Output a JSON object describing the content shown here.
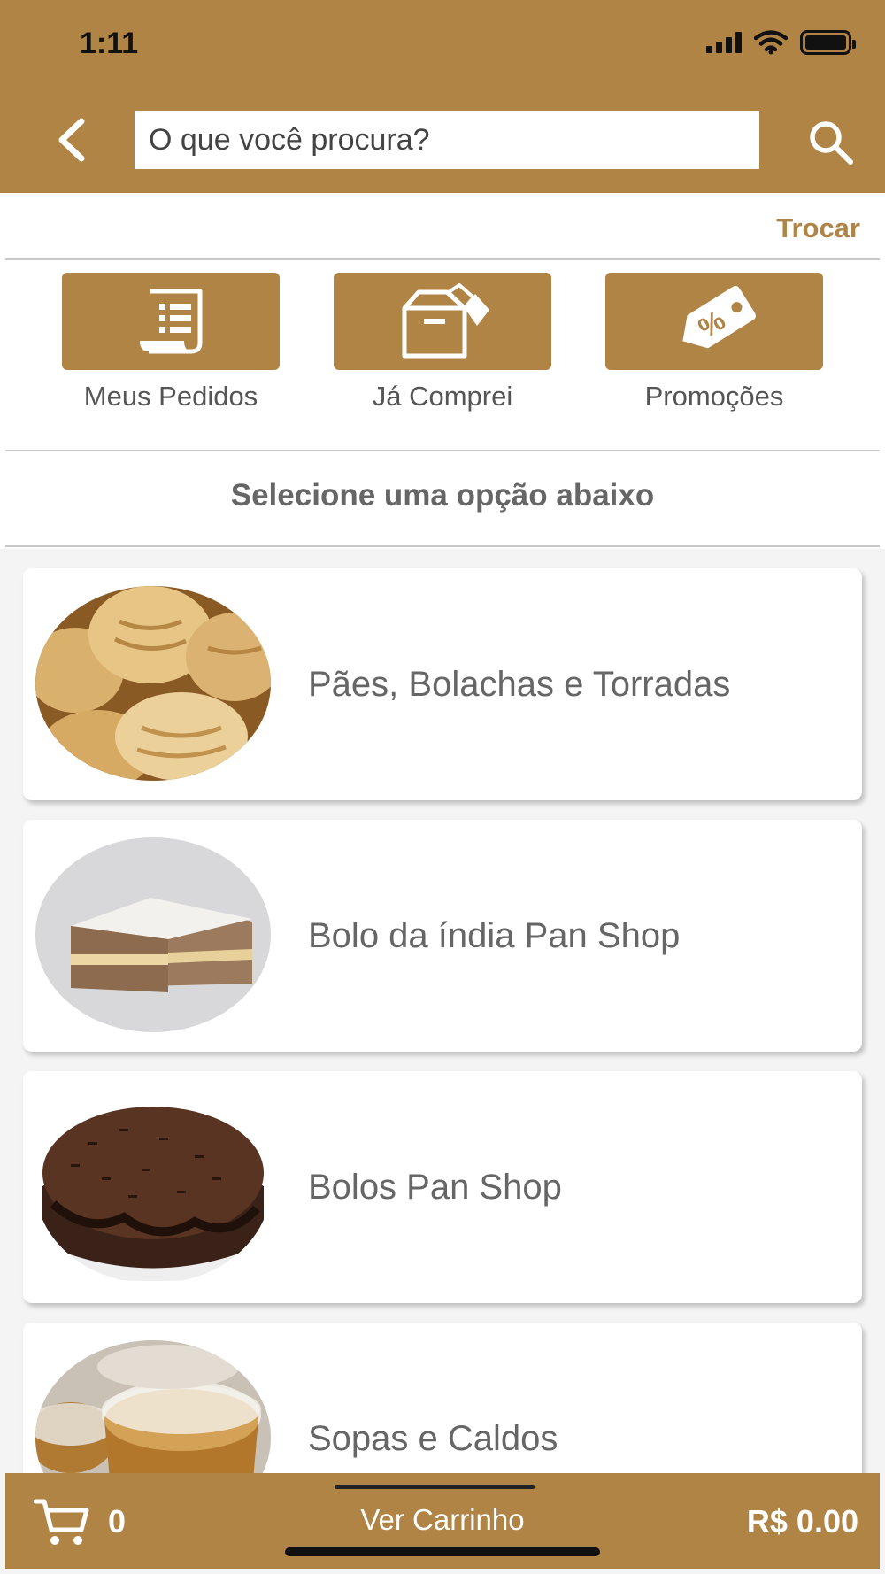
{
  "status_bar": {
    "time": "1:11"
  },
  "search": {
    "placeholder": "O que você procura?"
  },
  "store": {
    "switch_label": "Trocar"
  },
  "quick_actions": [
    {
      "label": "Meus Pedidos",
      "icon": "receipt-icon"
    },
    {
      "label": "Já Comprei",
      "icon": "open-box-icon"
    },
    {
      "label": "Promoções",
      "icon": "percent-tag-icon"
    }
  ],
  "section_title": "Selecione uma opção abaixo",
  "categories": [
    {
      "label": "Pães, Bolachas e Torradas",
      "image": "bread-rolls-image"
    },
    {
      "label": "Bolo da índia Pan Shop",
      "image": "layer-cake-slice-image"
    },
    {
      "label": "Bolos Pan Shop",
      "image": "chocolate-cake-image"
    },
    {
      "label": "Sopas e Caldos",
      "image": "soup-containers-image"
    }
  ],
  "cart": {
    "count": "0",
    "view_label": "Ver Carrinho",
    "total": "R$ 0.00"
  },
  "colors": {
    "brand": "#b08445",
    "text_muted": "#666666"
  }
}
